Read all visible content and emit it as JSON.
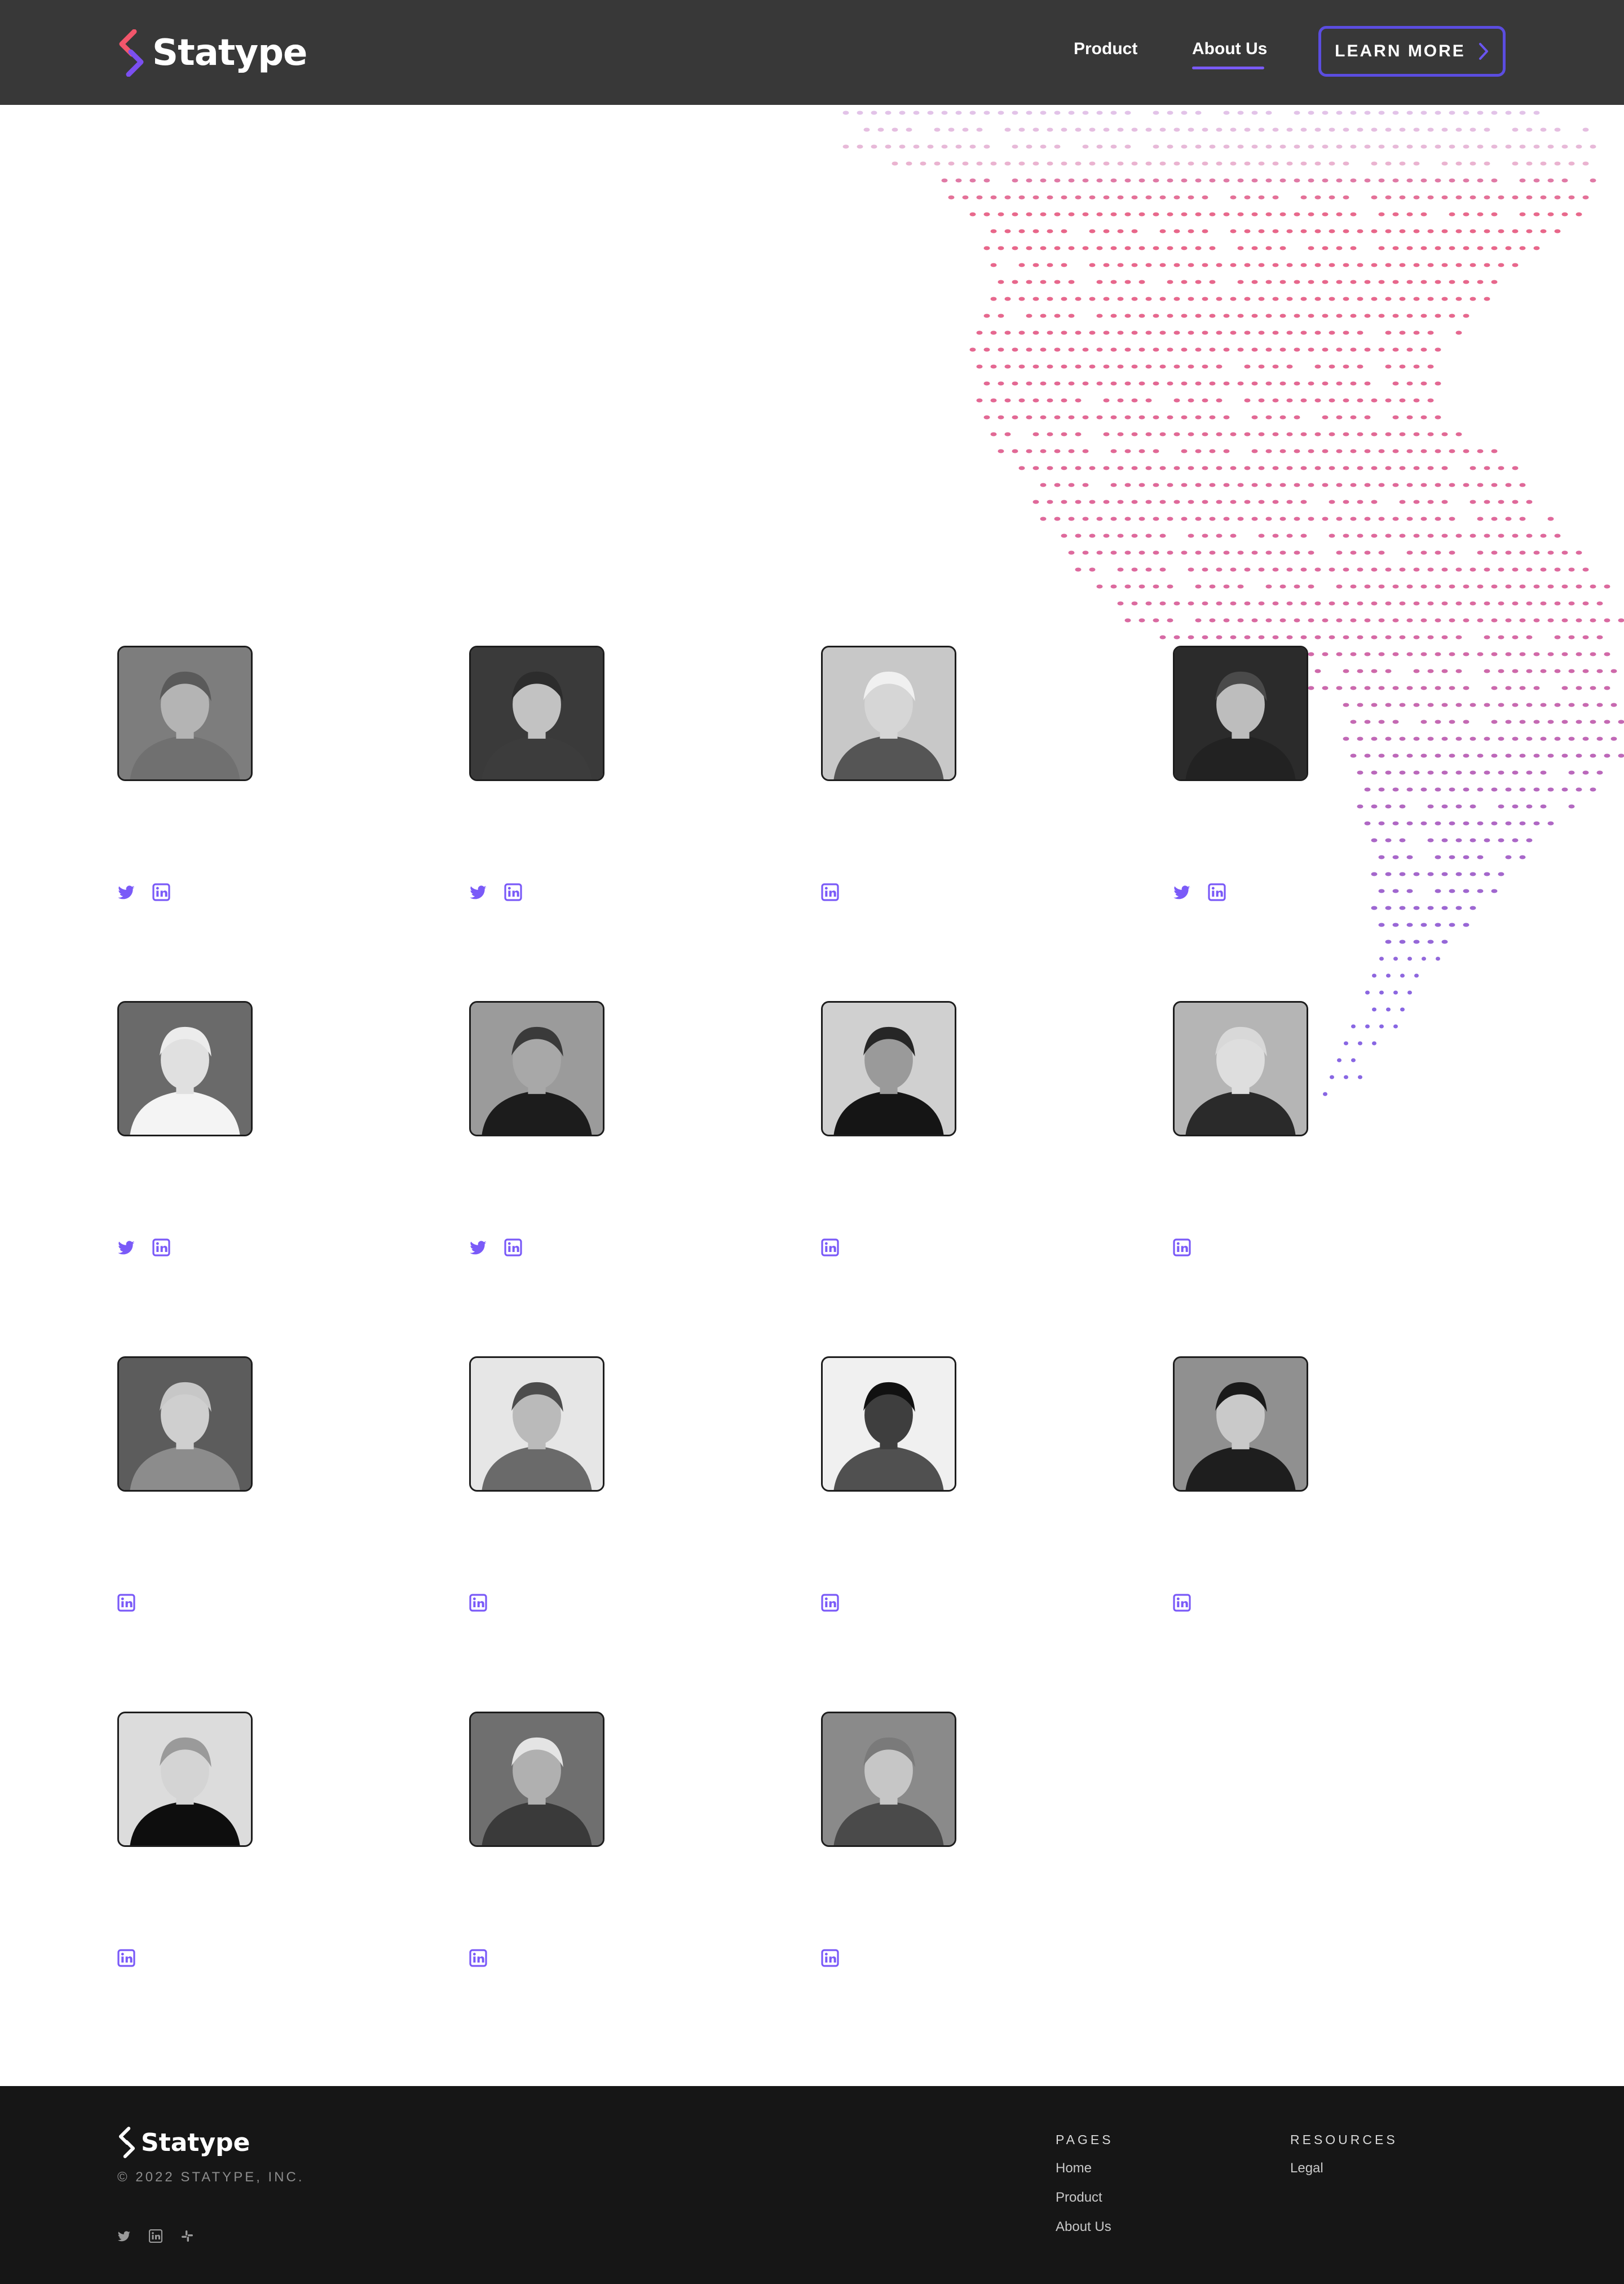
{
  "brand": {
    "name": "Statype",
    "logo_colors": [
      "#f2566b",
      "#7b4ff0"
    ]
  },
  "nav": {
    "items": [
      {
        "label": "Product"
      },
      {
        "label": "About Us",
        "active": true
      }
    ],
    "cta": {
      "label": "LEARN MORE",
      "icon": "chevron-right-icon"
    }
  },
  "decor": {
    "map": "dotted-world-map",
    "gradient": [
      "#e7577c",
      "#7b55e0"
    ]
  },
  "accent_color": "#7a5af8",
  "team": [
    {
      "photo": "portrait-1",
      "socials": [
        "twitter-icon",
        "linkedin-icon"
      ]
    },
    {
      "photo": "portrait-2",
      "socials": [
        "twitter-icon",
        "linkedin-icon"
      ]
    },
    {
      "photo": "portrait-3",
      "socials": [
        "linkedin-icon"
      ]
    },
    {
      "photo": "portrait-4",
      "socials": [
        "twitter-icon",
        "linkedin-icon"
      ]
    },
    {
      "photo": "portrait-5",
      "socials": [
        "twitter-icon",
        "linkedin-icon"
      ]
    },
    {
      "photo": "portrait-6",
      "socials": [
        "twitter-icon",
        "linkedin-icon"
      ]
    },
    {
      "photo": "portrait-7",
      "socials": [
        "linkedin-icon"
      ]
    },
    {
      "photo": "portrait-8",
      "socials": [
        "linkedin-icon"
      ]
    },
    {
      "photo": "portrait-9",
      "socials": [
        "linkedin-icon"
      ]
    },
    {
      "photo": "portrait-10",
      "socials": [
        "linkedin-icon"
      ]
    },
    {
      "photo": "portrait-11",
      "socials": [
        "linkedin-icon"
      ]
    },
    {
      "photo": "portrait-12",
      "socials": [
        "linkedin-icon"
      ]
    },
    {
      "photo": "portrait-13",
      "socials": [
        "linkedin-icon"
      ]
    },
    {
      "photo": "portrait-14",
      "socials": [
        "linkedin-icon"
      ]
    },
    {
      "photo": "portrait-15",
      "socials": [
        "linkedin-icon"
      ]
    }
  ],
  "footer": {
    "brand": "Statype",
    "copyright": "© 2022 STATYPE, INC.",
    "socials": [
      "twitter-icon",
      "linkedin-icon",
      "slack-icon"
    ],
    "columns": [
      {
        "heading": "PAGES",
        "links": [
          "Home",
          "Product",
          "About Us"
        ]
      },
      {
        "heading": "RESOURCES",
        "links": [
          "Legal"
        ]
      }
    ]
  }
}
